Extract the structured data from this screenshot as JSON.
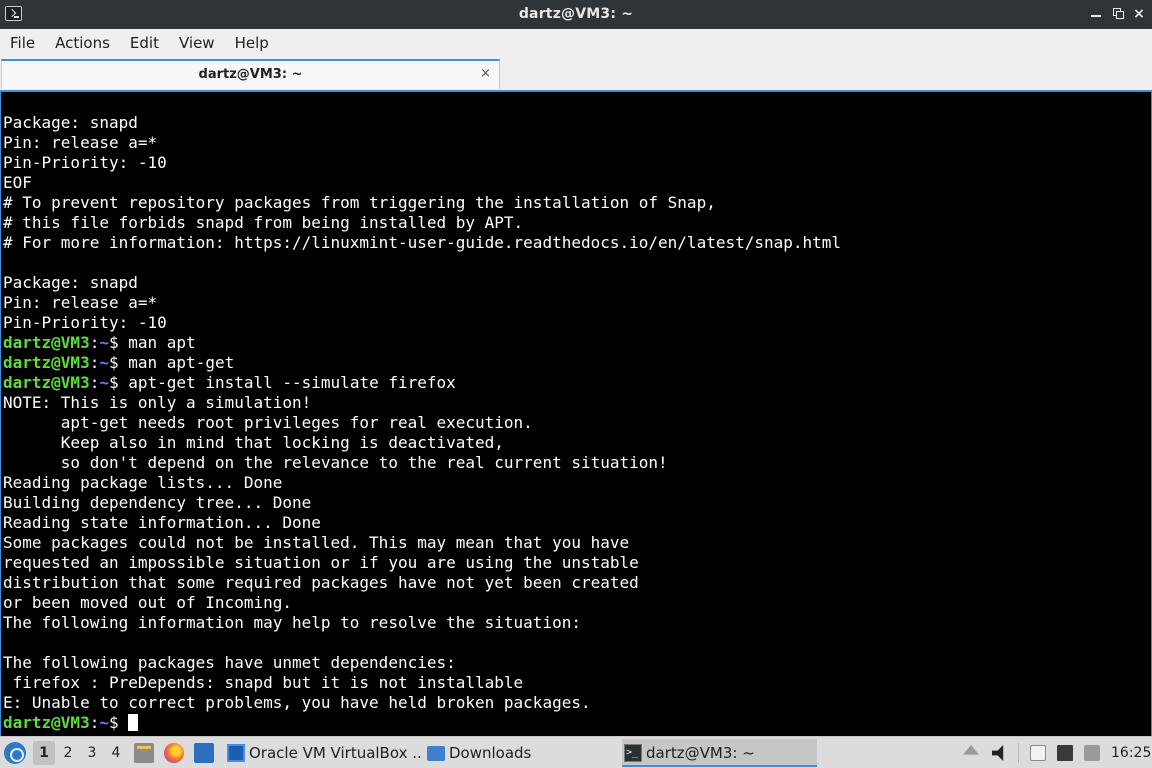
{
  "window": {
    "title": "dartz@VM3: ~"
  },
  "menu": [
    "File",
    "Actions",
    "Edit",
    "View",
    "Help"
  ],
  "tab": {
    "label": "dartz@VM3: ~",
    "close": "×"
  },
  "prompt": {
    "user": "dartz@VM3",
    "path": "~",
    "sep": ":",
    "symbol": "$"
  },
  "terminal_lines": [
    {
      "type": "text",
      "text": "Package: snapd"
    },
    {
      "type": "text",
      "text": "Pin: release a=*"
    },
    {
      "type": "text",
      "text": "Pin-Priority: -10"
    },
    {
      "type": "text",
      "text": "EOF"
    },
    {
      "type": "text",
      "text": "# To prevent repository packages from triggering the installation of Snap,"
    },
    {
      "type": "text",
      "text": "# this file forbids snapd from being installed by APT."
    },
    {
      "type": "text",
      "text": "# For more information: https://linuxmint-user-guide.readthedocs.io/en/latest/snap.html"
    },
    {
      "type": "text",
      "text": ""
    },
    {
      "type": "text",
      "text": "Package: snapd"
    },
    {
      "type": "text",
      "text": "Pin: release a=*"
    },
    {
      "type": "text",
      "text": "Pin-Priority: -10"
    },
    {
      "type": "cmd",
      "text": " man apt"
    },
    {
      "type": "cmd",
      "text": " man apt-get"
    },
    {
      "type": "cmd",
      "text": " apt-get install --simulate firefox"
    },
    {
      "type": "text",
      "text": "NOTE: This is only a simulation!"
    },
    {
      "type": "text",
      "text": "      apt-get needs root privileges for real execution."
    },
    {
      "type": "text",
      "text": "      Keep also in mind that locking is deactivated,"
    },
    {
      "type": "text",
      "text": "      so don't depend on the relevance to the real current situation!"
    },
    {
      "type": "text",
      "text": "Reading package lists... Done"
    },
    {
      "type": "text",
      "text": "Building dependency tree... Done"
    },
    {
      "type": "text",
      "text": "Reading state information... Done"
    },
    {
      "type": "text",
      "text": "Some packages could not be installed. This may mean that you have"
    },
    {
      "type": "text",
      "text": "requested an impossible situation or if you are using the unstable"
    },
    {
      "type": "text",
      "text": "distribution that some required packages have not yet been created"
    },
    {
      "type": "text",
      "text": "or been moved out of Incoming."
    },
    {
      "type": "text",
      "text": "The following information may help to resolve the situation:"
    },
    {
      "type": "text",
      "text": ""
    },
    {
      "type": "text",
      "text": "The following packages have unmet dependencies:"
    },
    {
      "type": "text",
      "text": " firefox : PreDepends: snapd but it is not installable"
    },
    {
      "type": "text",
      "text": "E: Unable to correct problems, you have held broken packages."
    },
    {
      "type": "cmd",
      "text": " ",
      "cursor": true
    }
  ],
  "taskbar": {
    "workspaces": [
      "1",
      "2",
      "3",
      "4"
    ],
    "active_workspace": "1",
    "tasks": [
      {
        "label": "Oracle VM VirtualBox ...",
        "icon": "virtualbox-icon"
      },
      {
        "label": "Downloads",
        "icon": "folder-icon"
      },
      {
        "label": "dartz@VM3: ~",
        "icon": "terminal-icon"
      }
    ],
    "clock": "16:25"
  },
  "colors": {
    "accent": "#3d8fdb",
    "prompt_user": "#5ddc3a",
    "prompt_path": "#5f7fff",
    "terminal_bg": "#000000",
    "terminal_fg": "#ffffff"
  }
}
